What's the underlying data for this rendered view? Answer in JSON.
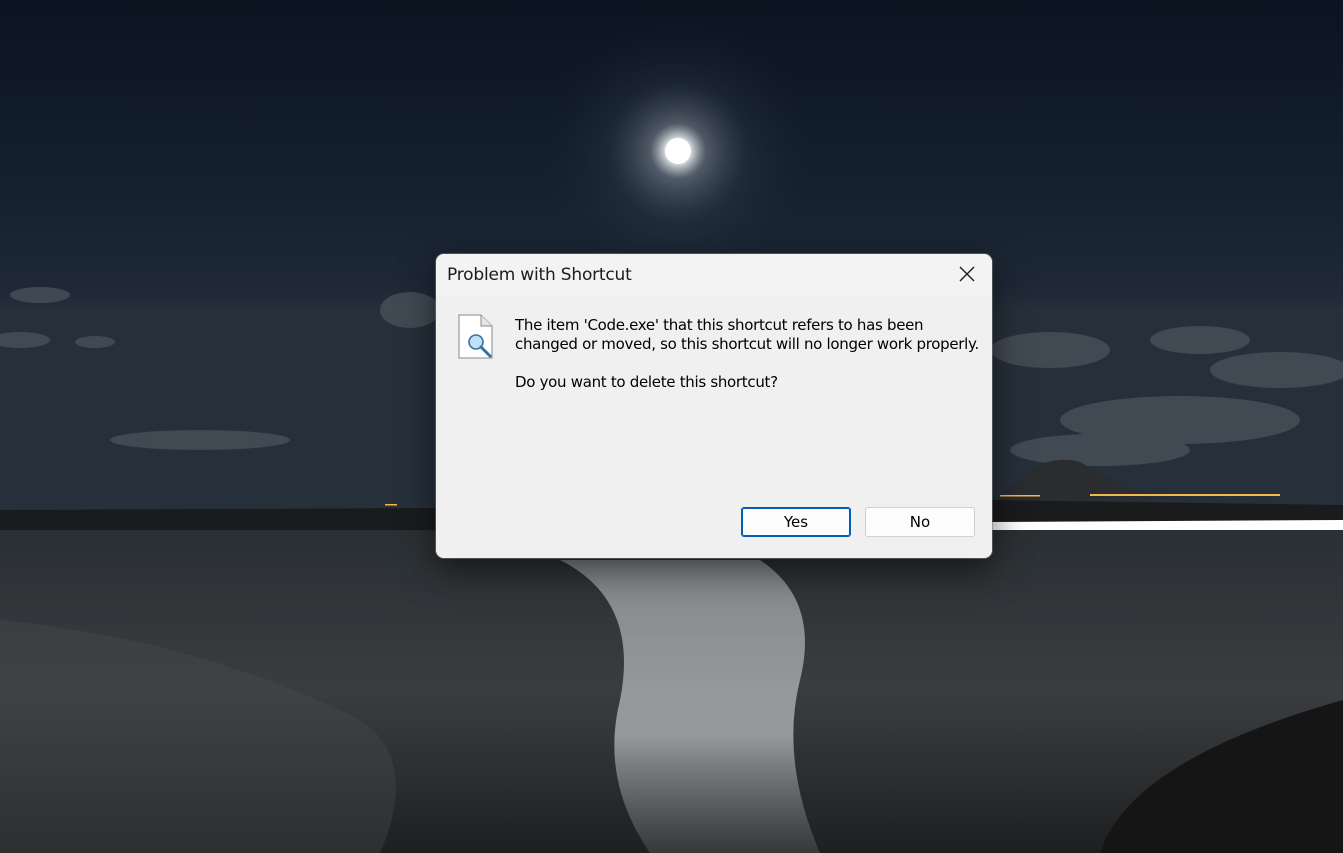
{
  "dialog": {
    "title": "Problem with Shortcut",
    "message_line1": "The item 'Code.exe' that this shortcut refers to has been changed or moved, so this shortcut will no longer work properly.",
    "message_line2": "Do you want to delete this shortcut?",
    "yes_label": "Yes",
    "no_label": "No",
    "icon": "file-search-icon",
    "close_icon": "close-icon"
  },
  "colors": {
    "dialog_bg": "#f0f0f0",
    "accent_border": "#005fb8"
  }
}
